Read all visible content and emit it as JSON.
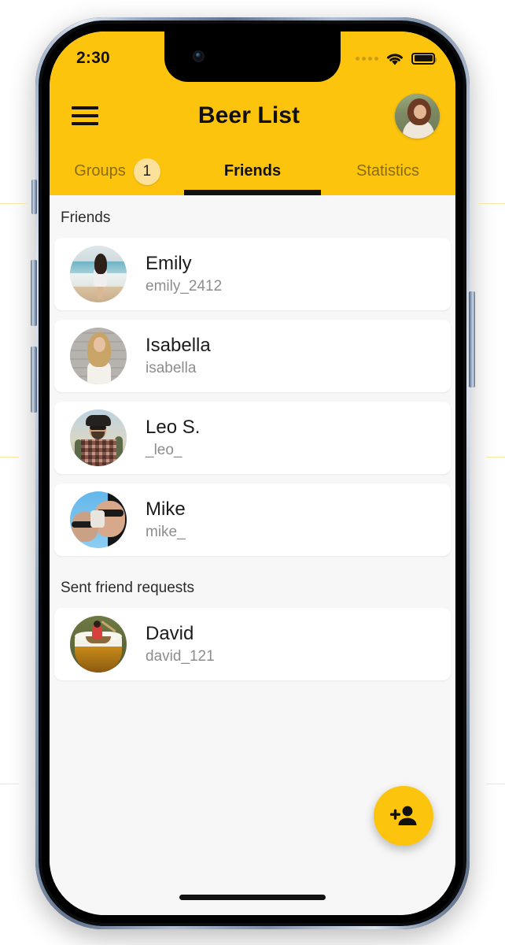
{
  "status_bar": {
    "time": "2:30",
    "signal_icon": "signal-dots-icon",
    "wifi_icon": "wifi-icon",
    "battery_icon": "battery-full-icon"
  },
  "header": {
    "menu_icon": "hamburger-menu-icon",
    "title": "Beer List",
    "avatar_name": "user-avatar"
  },
  "tabs": [
    {
      "label": "Groups",
      "badge": "1",
      "active": false
    },
    {
      "label": "Friends",
      "badge": "",
      "active": true
    },
    {
      "label": "Statistics",
      "badge": "",
      "active": false
    }
  ],
  "sections": [
    {
      "title": "Friends",
      "items": [
        {
          "name": "Emily",
          "username": "emily_2412"
        },
        {
          "name": "Isabella",
          "username": "isabella"
        },
        {
          "name": "Leo S.",
          "username": "_leo_"
        },
        {
          "name": "Mike",
          "username": "mike_"
        }
      ]
    },
    {
      "title": "Sent friend requests",
      "items": [
        {
          "name": "David",
          "username": "david_121"
        }
      ]
    }
  ],
  "fab": {
    "icon": "person-add-icon",
    "color": "#FDC40D"
  },
  "colors": {
    "brand_yellow": "#FDC40D",
    "badge_cream": "#FBE19A",
    "inactive_tab": "#8A6C10",
    "page_background": "#F7F7F7",
    "card_background": "#FFFFFF",
    "primary_text": "#1B1B1B",
    "secondary_text": "#8D8D8D"
  },
  "home_indicator": "home-indicator"
}
